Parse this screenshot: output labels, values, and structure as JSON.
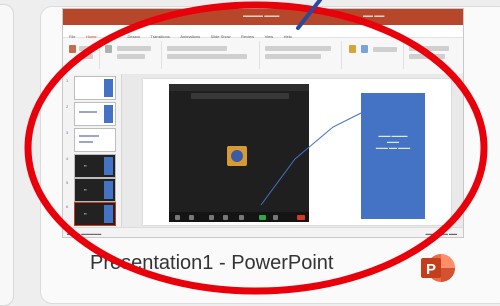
{
  "window_caption": "Presentation1 - PowerPoint",
  "app_icon_letter": "P",
  "thumbnail": {
    "menu": [
      "File",
      "Home",
      "Insert",
      "Design",
      "Transitions",
      "Animations",
      "Slide Show",
      "Review",
      "View",
      "Help"
    ],
    "slide_numbers": [
      "1",
      "2",
      "3",
      "4",
      "5",
      "6"
    ]
  },
  "colors": {
    "annotation_oval": "#e8000b",
    "annotation_stroke": "#2b4a9b",
    "powerpoint_brand": "#c43e1c"
  }
}
